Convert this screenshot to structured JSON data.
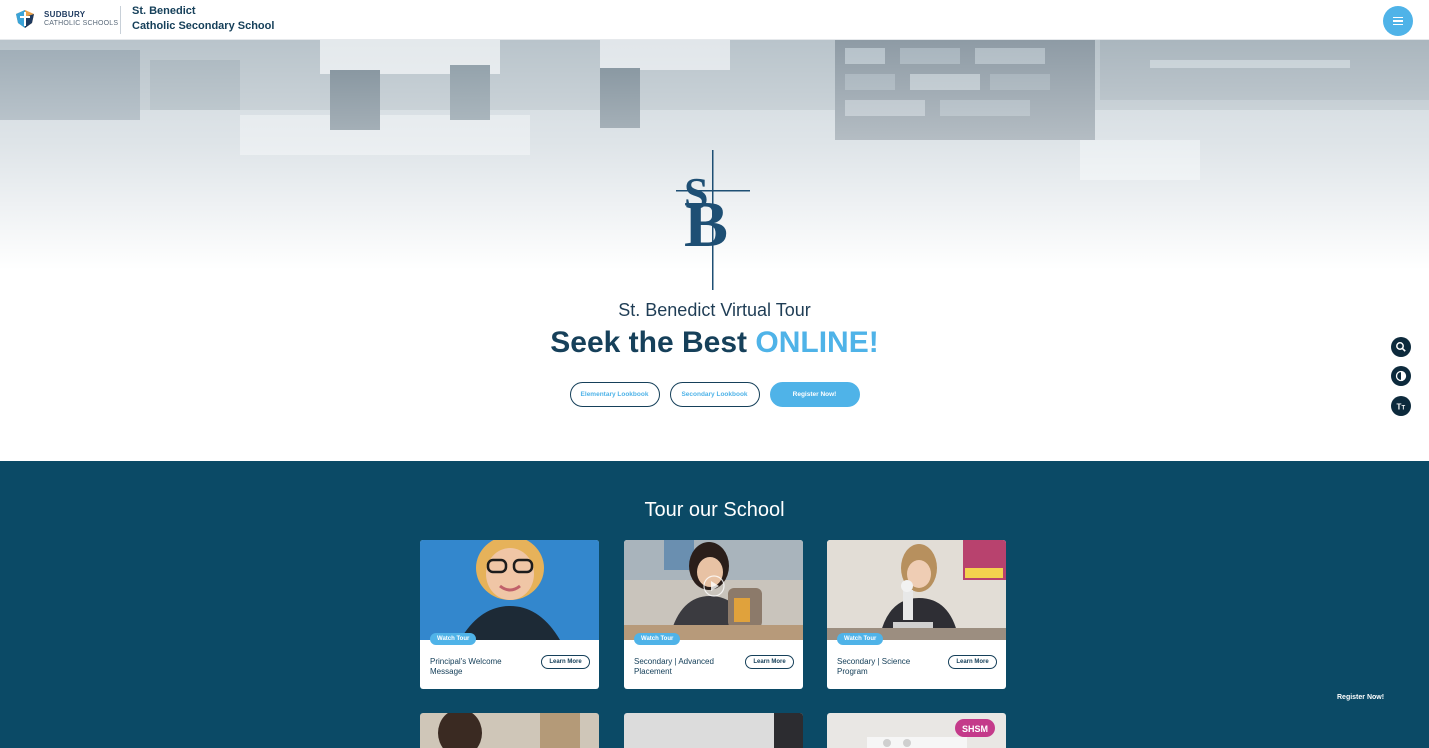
{
  "header": {
    "brand_line1": "SUDBURY",
    "brand_line2": "CATHOLIC SCHOOLS",
    "school_line1": "St. Benedict",
    "school_line2": "Catholic Secondary School",
    "menu_icon": "hamburger-menu-icon"
  },
  "hero": {
    "logo_text": "SB",
    "subtitle": "St. Benedict Virtual Tour",
    "title_main": "Seek the Best",
    "title_accent": "ONLINE!",
    "buttons": [
      {
        "label": "Elementary Lookbook",
        "style": "outline"
      },
      {
        "label": "Secondary Lookbook",
        "style": "outline"
      },
      {
        "label": "Register Now!",
        "style": "solid"
      }
    ]
  },
  "side_tools": [
    {
      "icon": "search-icon"
    },
    {
      "icon": "contrast-icon"
    },
    {
      "icon": "text-size-icon"
    }
  ],
  "tour": {
    "title": "Tour our School",
    "cards": [
      {
        "badge": "Watch Tour",
        "title": "Principal's Welcome Message",
        "button": "Learn More"
      },
      {
        "badge": "Watch Tour",
        "title": "Secondary | Advanced Placement",
        "button": "Learn More"
      },
      {
        "badge": "Watch Tour",
        "title": "Secondary | Science Program",
        "button": "Learn More"
      }
    ],
    "partial_third_label": "SHSM",
    "register_link": "Register Now!"
  },
  "colors": {
    "navy": "#16405a",
    "accent_blue": "#4fb3e8",
    "section_bg": "#0b4a66",
    "tool_dark": "#0d2a3c"
  }
}
